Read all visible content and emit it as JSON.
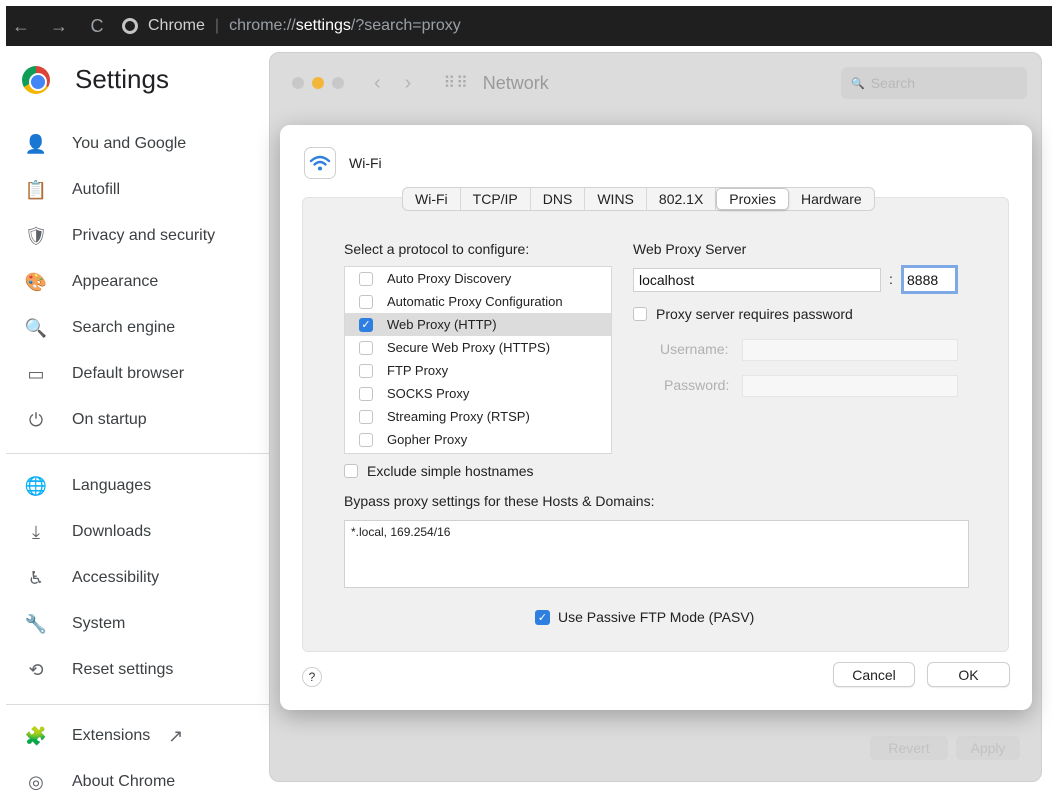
{
  "browser": {
    "back_glyph": "←",
    "forward_glyph": "→",
    "reload_glyph": "C",
    "site_name": "Chrome",
    "url_scheme": "chrome://",
    "url_host": "settings",
    "url_rest": "/?search=proxy"
  },
  "settings": {
    "title": "Settings",
    "items": [
      {
        "label": "You and Google",
        "icon": "person-icon",
        "glyph": "👤"
      },
      {
        "label": "Autofill",
        "icon": "clipboard-icon",
        "glyph": "📋"
      },
      {
        "label": "Privacy and security",
        "icon": "shield-icon",
        "glyph": "🛡"
      },
      {
        "label": "Appearance",
        "icon": "palette-icon",
        "glyph": "🎨"
      },
      {
        "label": "Search engine",
        "icon": "search-icon",
        "glyph": "🔍"
      },
      {
        "label": "Default browser",
        "icon": "browser-icon",
        "glyph": "▭"
      },
      {
        "label": "On startup",
        "icon": "power-icon",
        "glyph": "⏻"
      },
      {
        "label": "Languages",
        "icon": "globe-icon",
        "glyph": "🌐"
      },
      {
        "label": "Downloads",
        "icon": "download-icon",
        "glyph": "⤓"
      },
      {
        "label": "Accessibility",
        "icon": "accessibility-icon",
        "glyph": "♿"
      },
      {
        "label": "System",
        "icon": "wrench-icon",
        "glyph": "🔧"
      },
      {
        "label": "Reset settings",
        "icon": "restore-icon",
        "glyph": "⟲"
      },
      {
        "label": "Extensions",
        "icon": "puzzle-icon",
        "glyph": "🧩"
      },
      {
        "label": "About Chrome",
        "icon": "chrome-icon",
        "glyph": "◎"
      }
    ],
    "external_link_glyph": "↗"
  },
  "network_window": {
    "title": "Network",
    "search_placeholder": "Search",
    "search_glyph": "🔍",
    "revert_label": "Revert",
    "apply_label": "Apply"
  },
  "dialog": {
    "interface_name": "Wi-Fi",
    "tabs": [
      "Wi-Fi",
      "TCP/IP",
      "DNS",
      "WINS",
      "802.1X",
      "Proxies",
      "Hardware"
    ],
    "active_tab": "Proxies",
    "protocol_heading": "Select a protocol to configure:",
    "protocols": [
      {
        "label": "Auto Proxy Discovery",
        "checked": false
      },
      {
        "label": "Automatic Proxy Configuration",
        "checked": false
      },
      {
        "label": "Web Proxy (HTTP)",
        "checked": true
      },
      {
        "label": "Secure Web Proxy (HTTPS)",
        "checked": false
      },
      {
        "label": "FTP Proxy",
        "checked": false
      },
      {
        "label": "SOCKS Proxy",
        "checked": false
      },
      {
        "label": "Streaming Proxy (RTSP)",
        "checked": false
      },
      {
        "label": "Gopher Proxy",
        "checked": false
      }
    ],
    "server_heading": "Web Proxy Server",
    "server_host": "localhost",
    "colon": ":",
    "server_port": "8888",
    "requires_password_label": "Proxy server requires password",
    "username_label": "Username:",
    "password_label": "Password:",
    "exclude_label": "Exclude simple hostnames",
    "bypass_heading": "Bypass proxy settings for these Hosts & Domains:",
    "bypass_value": "*.local, 169.254/16",
    "passive_ftp_label": "Use Passive FTP Mode (PASV)",
    "passive_ftp_checked": true,
    "help_label": "?",
    "cancel_label": "Cancel",
    "ok_label": "OK",
    "check_glyph": "✓"
  },
  "colors": {
    "accent": "#2f7fe0",
    "focus_ring": "#7ea9e4",
    "chrome_bar": "#1f1f1f"
  }
}
